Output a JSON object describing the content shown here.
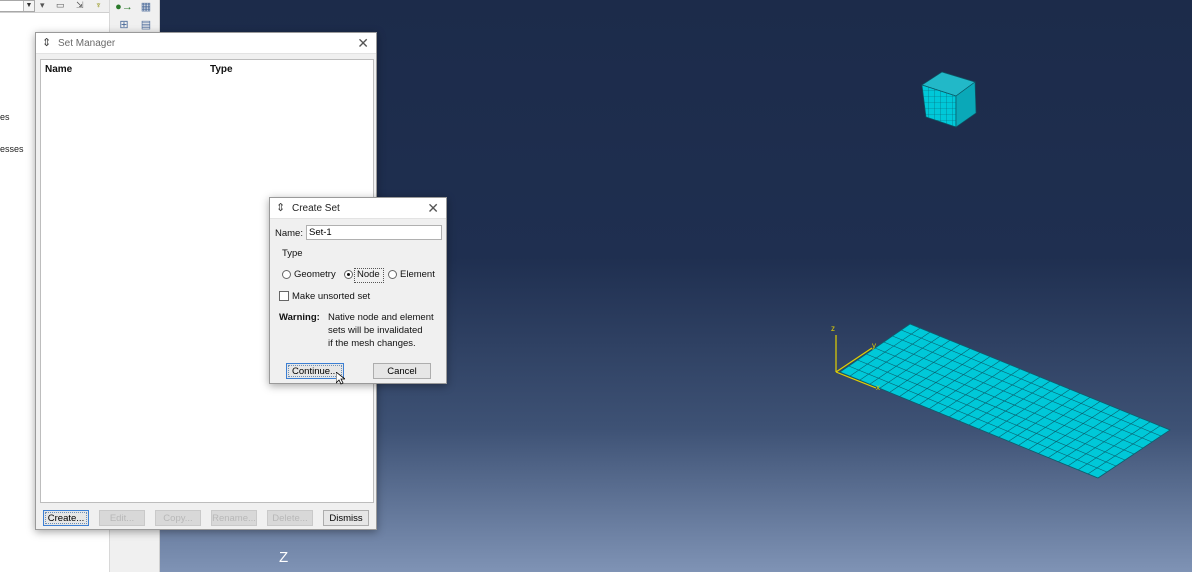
{
  "left_panel": {
    "tree_fragments": [
      "es",
      "esses"
    ]
  },
  "icons": {
    "combo_arrow": "chevron-down-icon",
    "dialog_icon": "abaqus-double-arrow-icon",
    "close": "close-icon"
  },
  "viewport": {
    "triad_label": "Z",
    "model_axis": {
      "z": "z",
      "y": "y",
      "x": "x"
    },
    "background_top": "#1c2b4a",
    "background_bottom": "#7f93b5",
    "mesh_color": "#00c8d8"
  },
  "set_manager": {
    "title": "Set Manager",
    "columns": [
      "Name",
      "Type"
    ],
    "buttons": {
      "create": "Create...",
      "edit": "Edit...",
      "copy": "Copy...",
      "rename": "Rename...",
      "delete": "Delete...",
      "dismiss": "Dismiss"
    }
  },
  "create_set": {
    "title": "Create Set",
    "name_label": "Name:",
    "name_value": "Set-1",
    "type_label": "Type",
    "type_options": [
      "Geometry",
      "Node",
      "Element"
    ],
    "selected_type": "Node",
    "unsorted_label": "Make unsorted set",
    "unsorted_checked": false,
    "warning_label": "Warning:",
    "warning_lines": [
      "Native node and element",
      "sets will be invalidated",
      "if the mesh changes."
    ],
    "continue_label": "Continue...",
    "cancel_label": "Cancel"
  }
}
